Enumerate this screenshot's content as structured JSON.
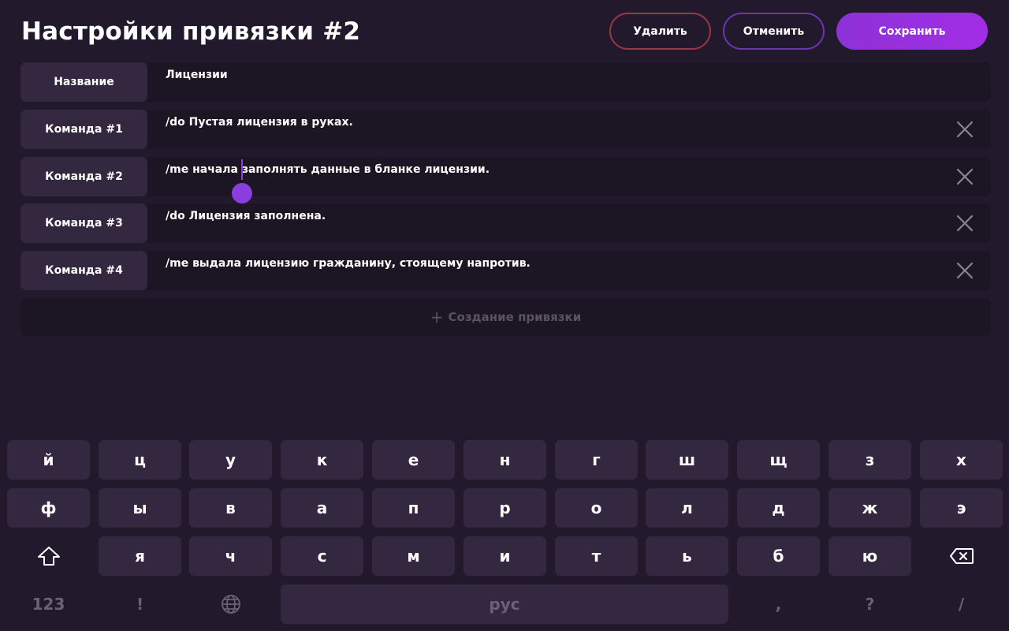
{
  "header": {
    "title": "Настройки привязки #2",
    "delete_label": "Удалить",
    "cancel_label": "Отменить",
    "save_label": "Сохранить"
  },
  "rows": [
    {
      "label": "Название",
      "value": "Лицензии",
      "removable": false
    },
    {
      "label": "Команда #1",
      "value": "/do Пустая лицензия в руках.",
      "removable": true
    },
    {
      "label": "Команда #2",
      "value": "/me начала заполнять данные в бланке лицензии.",
      "removable": true
    },
    {
      "label": "Команда #3",
      "value": "/do Лицензия заполнена.",
      "removable": true
    },
    {
      "label": "Команда #4",
      "value": "/me выдала лицензию гражданину, стоящему напротив.",
      "removable": true
    }
  ],
  "create": {
    "plus": "+",
    "label": "Создание привязки"
  },
  "keyboard": {
    "row1": [
      "й",
      "ц",
      "у",
      "к",
      "е",
      "н",
      "г",
      "ш",
      "щ",
      "з",
      "х"
    ],
    "row2": [
      "ф",
      "ы",
      "в",
      "а",
      "п",
      "р",
      "о",
      "л",
      "д",
      "ж",
      "э"
    ],
    "row3": [
      "я",
      "ч",
      "с",
      "м",
      "и",
      "т",
      "ь",
      "б",
      "ю"
    ],
    "numbers_label": "123",
    "exclaim_label": "!",
    "space_label": "рус",
    "comma_label": ",",
    "question_label": "?",
    "slash_label": "/",
    "icons": {
      "shift": "shift-icon",
      "backspace": "backspace-icon",
      "language": "globe-icon",
      "remove": "close-icon"
    }
  },
  "colors": {
    "background": "#221a2c",
    "accent": "#9b2fe0",
    "delete_border": "#9c3447",
    "cancel_border": "#6b35b0"
  }
}
